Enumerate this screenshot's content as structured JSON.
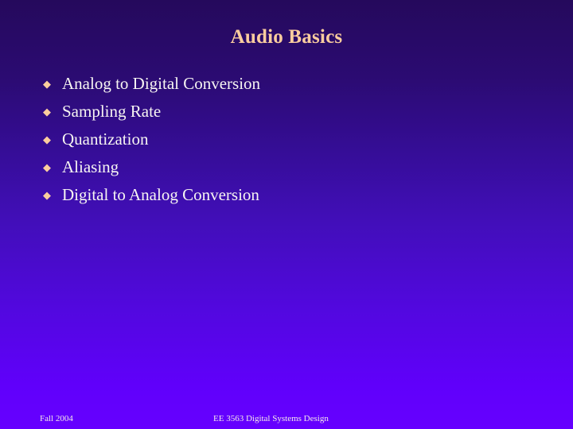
{
  "slide": {
    "title": "Audio Basics",
    "background": {
      "gradient_top_color": "#25095c",
      "gradient_bottom_color": "#6600ff"
    },
    "title_color": "#fbcd9e",
    "body_text_color": "#f7f5f2",
    "bullet_marker_color": "#fbcd9e",
    "bullet_glyph": "◆",
    "bullet_icon_name": "diamond-bullet-icon",
    "bullets": [
      {
        "label": "Analog to Digital Conversion"
      },
      {
        "label": "Sampling Rate"
      },
      {
        "label": "Quantization"
      },
      {
        "label": "Aliasing"
      },
      {
        "label": "Digital to Analog Conversion"
      }
    ],
    "footer": {
      "left": "Fall 2004",
      "center": "EE 3563 Digital Systems Design",
      "color": "#f3e6ea"
    }
  }
}
